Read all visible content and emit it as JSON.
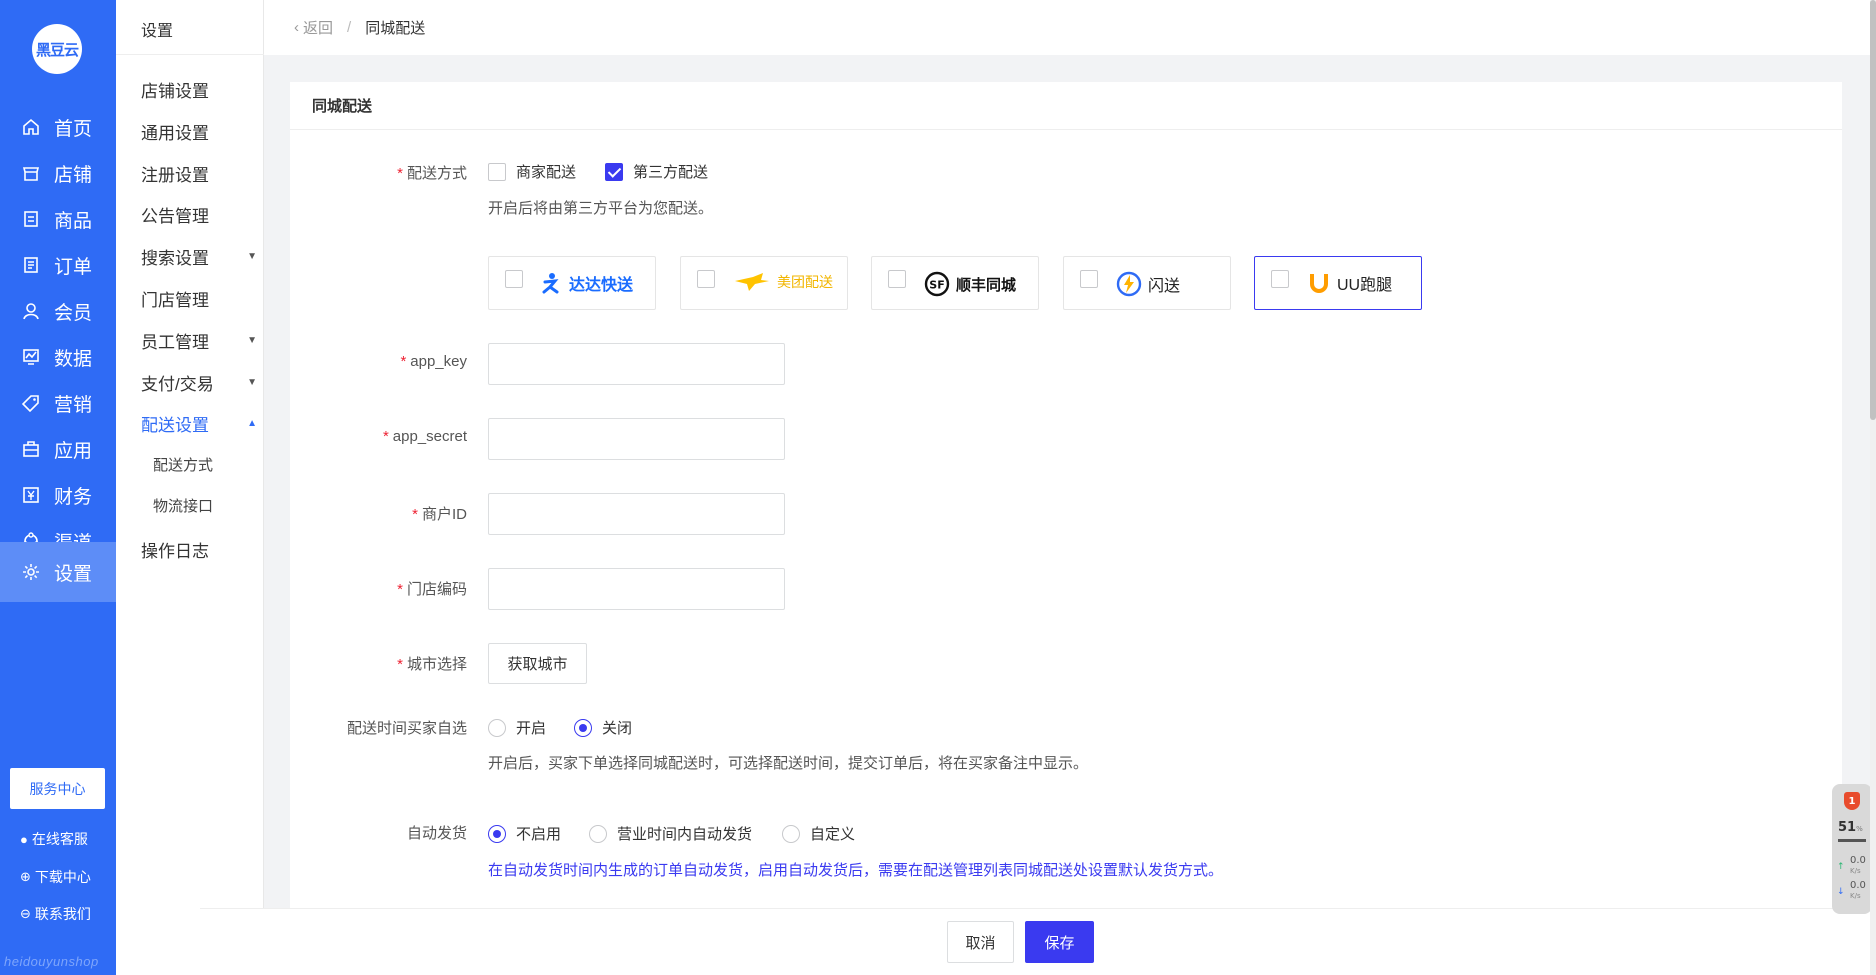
{
  "app": {
    "logo_text": "黑豆云",
    "watermark": "heidouyunshop"
  },
  "nav": {
    "items": [
      {
        "label": "首页",
        "icon": "home-icon"
      },
      {
        "label": "店铺",
        "icon": "store-icon"
      },
      {
        "label": "商品",
        "icon": "goods-icon"
      },
      {
        "label": "订单",
        "icon": "order-icon"
      },
      {
        "label": "会员",
        "icon": "member-icon"
      },
      {
        "label": "数据",
        "icon": "data-icon"
      },
      {
        "label": "营销",
        "icon": "tag-icon"
      },
      {
        "label": "应用",
        "icon": "app-icon"
      },
      {
        "label": "财务",
        "icon": "finance-icon"
      },
      {
        "label": "渠道",
        "icon": "channel-icon"
      },
      {
        "label": "设置",
        "icon": "gear-icon"
      }
    ],
    "active": "设置",
    "service_center": "服务中心",
    "links": [
      {
        "label": "在线客服",
        "icon": "chat-icon"
      },
      {
        "label": "下载中心",
        "icon": "download-icon"
      },
      {
        "label": "联系我们",
        "icon": "contact-icon"
      }
    ]
  },
  "submenu": {
    "title": "设置",
    "items": [
      {
        "label": "店铺设置"
      },
      {
        "label": "通用设置"
      },
      {
        "label": "注册设置"
      },
      {
        "label": "公告管理"
      },
      {
        "label": "搜索设置"
      },
      {
        "label": "门店管理"
      },
      {
        "label": "员工管理"
      },
      {
        "label": "支付/交易"
      },
      {
        "label": "配送设置"
      },
      {
        "label": "操作日志"
      }
    ],
    "children": [
      {
        "label": "配送方式"
      },
      {
        "label": "物流接口"
      }
    ],
    "active": "配送设置"
  },
  "breadcrumb": {
    "back": "返回",
    "current": "同城配送"
  },
  "card": {
    "title": "同城配送",
    "delivery_method": {
      "label": "配送方式",
      "options": [
        {
          "label": "商家配送",
          "checked": false
        },
        {
          "label": "第三方配送",
          "checked": true
        }
      ],
      "hint": "开启后将由第三方平台为您配送。"
    },
    "providers": [
      {
        "name": "达达快送",
        "color": "#1a6cff",
        "checked": false,
        "selected": false
      },
      {
        "name": "美团配送",
        "color": "#ffc300",
        "checked": false,
        "selected": false
      },
      {
        "name": "顺丰同城",
        "color": "#111111",
        "checked": false,
        "selected": false
      },
      {
        "name": "闪送",
        "color": "#2f6bf5",
        "checked": false,
        "selected": false
      },
      {
        "name": "UU跑腿",
        "color": "#ff9d00",
        "checked": false,
        "selected": true
      }
    ],
    "fields": {
      "app_key": {
        "label": "app_key",
        "value": "",
        "placeholder": ""
      },
      "app_secret": {
        "label": "app_secret",
        "value": "",
        "placeholder": ""
      },
      "merchant_id": {
        "label": "商户ID",
        "value": "",
        "placeholder": ""
      },
      "store_code": {
        "label": "门店编码",
        "value": "",
        "placeholder": ""
      }
    },
    "city": {
      "label": "城市选择",
      "button": "获取城市"
    },
    "buyer_time": {
      "label": "配送时间买家自选",
      "options": [
        {
          "label": "开启",
          "selected": false
        },
        {
          "label": "关闭",
          "selected": true
        }
      ],
      "hint": "开启后，买家下单选择同城配送时，可选择配送时间，提交订单后，将在买家备注中显示。"
    },
    "auto_ship": {
      "label": "自动发货",
      "options": [
        {
          "label": "不启用",
          "selected": true
        },
        {
          "label": "营业时间内自动发货",
          "selected": false
        },
        {
          "label": "自定义",
          "selected": false
        }
      ],
      "hint": "在自动发货时间内生成的订单自动发货，启用自动发货后，需要在配送管理列表同城配送处设置默认发货方式。"
    }
  },
  "footer": {
    "cancel": "取消",
    "save": "保存"
  },
  "widget": {
    "badge": "1",
    "percent": "51",
    "percent_unit": "%",
    "up": "0.0",
    "down": "0.0",
    "unit": "K/s"
  }
}
